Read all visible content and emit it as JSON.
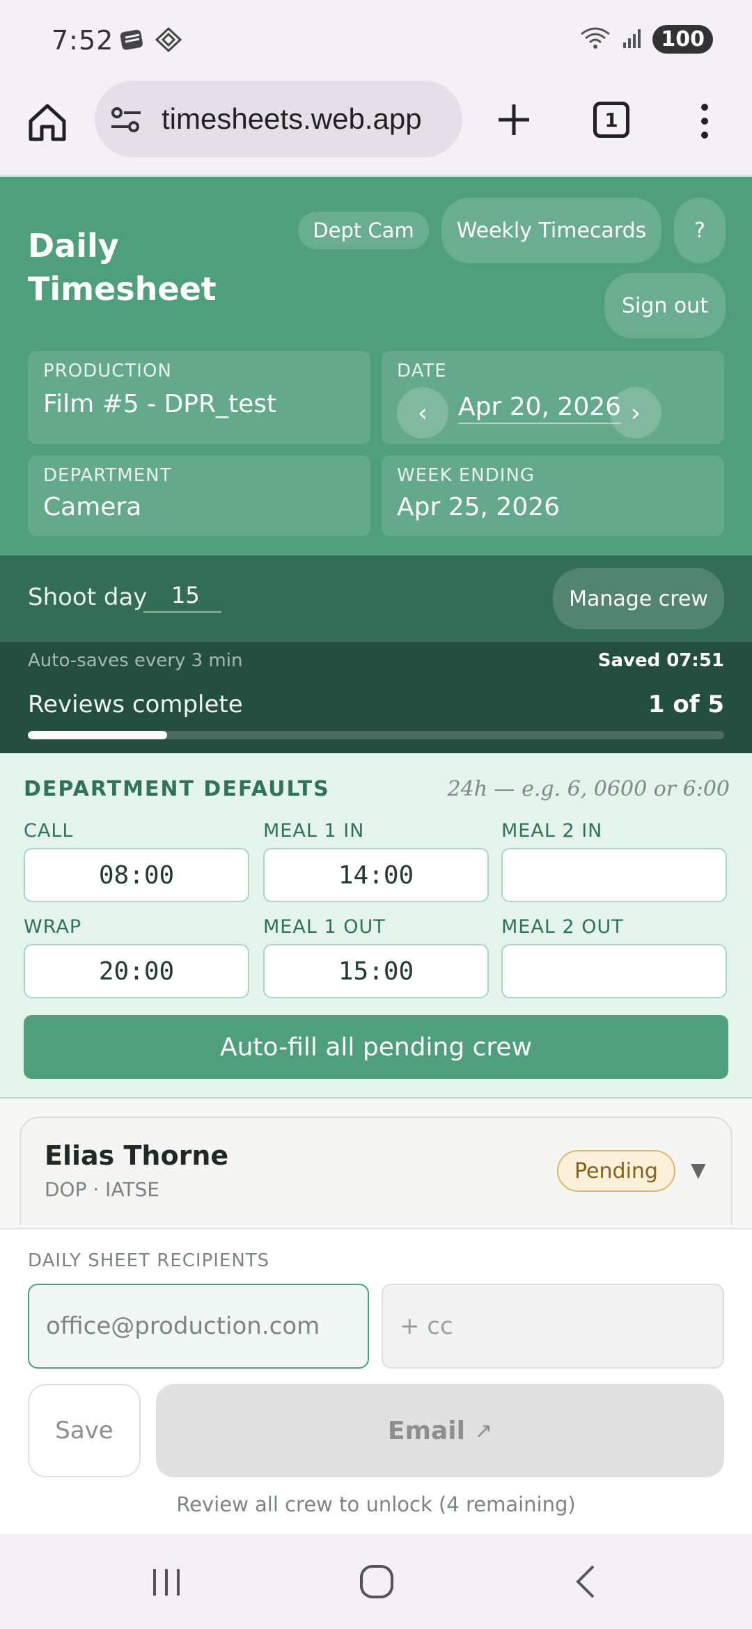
{
  "status": {
    "time": "7:52",
    "battery": "100"
  },
  "browser": {
    "url": "timesheets.web.app",
    "tab_count": "1"
  },
  "header": {
    "title": "Daily Timesheet",
    "dept_badge": "Dept Cam",
    "weekly_button": "Weekly Timecards",
    "help_button": "?",
    "signout_button": "Sign out",
    "production_label": "PRODUCTION",
    "production_value": "Film #5 - DPR_test",
    "date_label": "DATE",
    "date_value": "Apr 20, 2026",
    "prev": "‹",
    "next": "›",
    "department_label": "DEPARTMENT",
    "department_value": "Camera",
    "week_ending_label": "WEEK ENDING",
    "week_ending_value": "Apr 25, 2026"
  },
  "shoot": {
    "label": "Shoot day",
    "value": "15",
    "manage_button": "Manage crew"
  },
  "save": {
    "autosave_text": "Auto-saves every 3 min",
    "saved_text": "Saved 07:51",
    "reviews_label": "Reviews complete",
    "reviews_count": "1 of 5",
    "progress_fraction": 0.2
  },
  "defaults": {
    "heading": "DEPARTMENT DEFAULTS",
    "hint": "24h — e.g. 6, 0600 or 6:00",
    "call_label": "CALL",
    "call_value": "08:00",
    "meal1in_label": "MEAL 1 IN",
    "meal1in_value": "14:00",
    "meal2in_label": "MEAL 2 IN",
    "meal2in_value": "",
    "wrap_label": "WRAP",
    "wrap_value": "20:00",
    "meal1out_label": "MEAL 1 OUT",
    "meal1out_value": "15:00",
    "meal2out_label": "MEAL 2 OUT",
    "meal2out_value": "",
    "autofill_button": "Auto-fill all pending crew"
  },
  "crew": [
    {
      "name": "Elias Thorne",
      "role": "DOP · IATSE",
      "status": "Pending",
      "status_color": "#fbf0d9"
    }
  ],
  "recipients": {
    "heading": "DAILY SHEET RECIPIENTS",
    "to_placeholder": "office@production.com",
    "cc_placeholder": "+ cc",
    "save_button": "Save",
    "email_button": "Email",
    "email_icon": "↗",
    "unlock_text": "Review all crew to unlock (4 remaining)"
  },
  "colors": {
    "accent": "#4f9e7c",
    "dark": "#336d55",
    "darker": "#244f40"
  }
}
